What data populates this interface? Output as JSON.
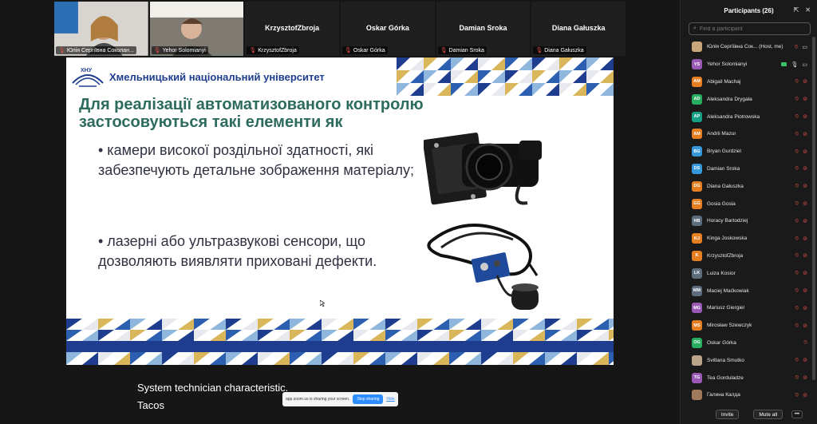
{
  "video_strip": [
    {
      "big_name": "",
      "tag": "Юлія Сергіївна Соколан...",
      "has_video": true
    },
    {
      "big_name": "",
      "tag": "Yehor Solomianyi",
      "has_video": true
    },
    {
      "big_name": "KrzysztofZbroja",
      "tag": "KrzysztofZbroja",
      "has_video": false
    },
    {
      "big_name": "Oskar Górka",
      "tag": "Oskar Górka",
      "has_video": false
    },
    {
      "big_name": "Damian Sroka",
      "tag": "Damian Sroka",
      "has_video": false
    },
    {
      "big_name": "Diana Gałuszka",
      "tag": "Diana Gałuszka",
      "has_video": false
    }
  ],
  "slide": {
    "university": "Хмельницький національний університет",
    "logo_text": "ХНУ",
    "title": "Для реалізації автоматизованого контролю застосовуються такі елементи як",
    "bullet1": "• камери високої роздільної здатності, які забезпечують детальне зображення матеріалу;",
    "bullet2": "• лазерні або ультразвукові сенсори, що дозволяють виявляти приховані дефекти."
  },
  "captions": {
    "line1": "System technician characteristic.",
    "line2": "Tacos"
  },
  "share_bar": {
    "text": "app.zoom.us is sharing your screen.",
    "stop_label": "Stop sharing",
    "hide_label": "Hide"
  },
  "panel": {
    "title": "Participants (26)",
    "search_placeholder": "Find a participant",
    "invite_label": "Invite",
    "mute_all_label": "Mute all",
    "more_label": "•••",
    "participants": [
      {
        "initials": "",
        "name": "Юлія Сергіївна Сок... (Host, me)",
        "color": "#c9a77a",
        "mic_on": false,
        "cam_on": true
      },
      {
        "initials": "YS",
        "name": "Yehor Solomianyi",
        "color": "#9b59b6",
        "mic_on": true,
        "cam_on": true,
        "active": true
      },
      {
        "initials": "AM",
        "name": "Abigail Machaj",
        "color": "#e67e22",
        "mic_on": false,
        "cam_on": false
      },
      {
        "initials": "AD",
        "name": "Aleksandra Drygała",
        "color": "#27ae60",
        "mic_on": false,
        "cam_on": false
      },
      {
        "initials": "AP",
        "name": "Aleksandra Piotrowska",
        "color": "#16a085",
        "mic_on": false,
        "cam_on": false
      },
      {
        "initials": "AM",
        "name": "Andrii Mazur",
        "color": "#e67e22",
        "mic_on": false,
        "cam_on": false
      },
      {
        "initials": "BG",
        "name": "Bryan Gurdziel",
        "color": "#3498db",
        "mic_on": false,
        "cam_on": false
      },
      {
        "initials": "DS",
        "name": "Damian Sroka",
        "color": "#3498db",
        "mic_on": false,
        "cam_on": false
      },
      {
        "initials": "DG",
        "name": "Diana Gałuszka",
        "color": "#e67e22",
        "mic_on": false,
        "cam_on": false
      },
      {
        "initials": "GG",
        "name": "Gosia Gosia",
        "color": "#e67e22",
        "mic_on": false,
        "cam_on": false
      },
      {
        "initials": "HB",
        "name": "Horacy Bartodziej",
        "color": "#5d6d7e",
        "mic_on": false,
        "cam_on": false
      },
      {
        "initials": "KJ",
        "name": "Kinga Joskowska",
        "color": "#e67e22",
        "mic_on": false,
        "cam_on": false
      },
      {
        "initials": "K",
        "name": "KrzysztofZbroja",
        "color": "#e67e22",
        "mic_on": false,
        "cam_on": false
      },
      {
        "initials": "LK",
        "name": "Luiza Kosior",
        "color": "#5d6d7e",
        "mic_on": false,
        "cam_on": false
      },
      {
        "initials": "MM",
        "name": "Maciej Maćkowiak",
        "color": "#5d6d7e",
        "mic_on": false,
        "cam_on": false
      },
      {
        "initials": "MG",
        "name": "Mariusz Giergiel",
        "color": "#9b59b6",
        "mic_on": false,
        "cam_on": false
      },
      {
        "initials": "MS",
        "name": "Mirosław Szewczyk",
        "color": "#e67e22",
        "mic_on": false,
        "cam_on": false
      },
      {
        "initials": "OG",
        "name": "Oskar Górka",
        "color": "#27ae60",
        "mic_on": false,
        "cam_on": null
      },
      {
        "initials": "",
        "name": "Svitlana Smutko",
        "color": "#bba58a",
        "mic_on": false,
        "cam_on": false
      },
      {
        "initials": "TG",
        "name": "Tea Gorduladze",
        "color": "#9b59b6",
        "mic_on": false,
        "cam_on": false
      },
      {
        "initials": "",
        "name": "Галина Калда",
        "color": "#a0785a",
        "mic_on": false,
        "cam_on": false
      }
    ]
  }
}
